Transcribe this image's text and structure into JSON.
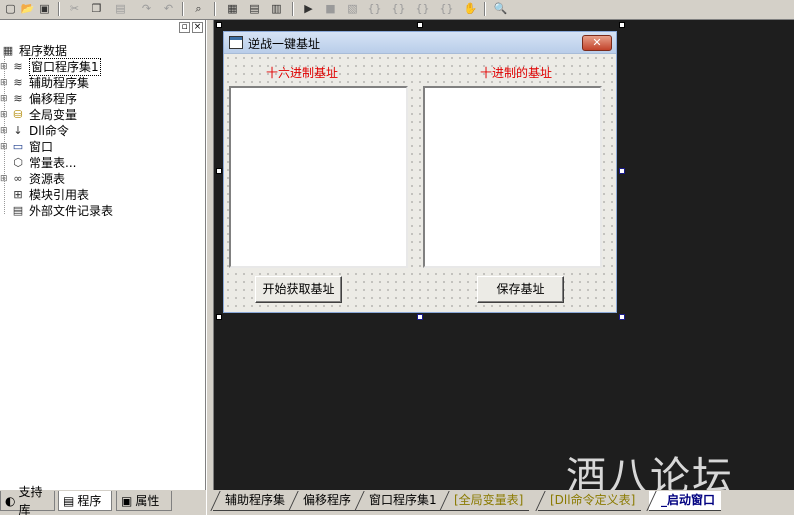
{
  "toolbar": {
    "buttons": [
      {
        "name": "new",
        "glyph": "▢"
      },
      {
        "name": "open",
        "glyph": "📂"
      },
      {
        "name": "save",
        "glyph": "▣"
      },
      {
        "name": "cut",
        "glyph": "✂"
      },
      {
        "name": "copy",
        "glyph": "❐"
      },
      {
        "name": "paste",
        "glyph": "▤"
      },
      {
        "name": "redo",
        "glyph": "↷"
      },
      {
        "name": "undo",
        "glyph": "↶"
      },
      {
        "name": "preview",
        "glyph": "⌕"
      },
      {
        "name": "layout1",
        "glyph": "▦"
      },
      {
        "name": "layout2",
        "glyph": "▤"
      },
      {
        "name": "layout3",
        "glyph": "▥"
      },
      {
        "name": "run",
        "glyph": "▶"
      },
      {
        "name": "stop",
        "glyph": "■"
      },
      {
        "name": "compile",
        "glyph": "▧"
      },
      {
        "name": "step-into",
        "glyph": "{}"
      },
      {
        "name": "step-over",
        "glyph": "{}"
      },
      {
        "name": "step-out",
        "glyph": "{}"
      },
      {
        "name": "step-run",
        "glyph": "{}"
      },
      {
        "name": "hand",
        "glyph": "✋"
      },
      {
        "name": "find",
        "glyph": "🔍"
      }
    ]
  },
  "tree": {
    "root": "程序数据",
    "items": [
      {
        "label": "窗口程序集1",
        "icon": "stack-icon",
        "glyph": "≋",
        "selected": true
      },
      {
        "label": "辅助程序集",
        "icon": "stack-icon",
        "glyph": "≋"
      },
      {
        "label": "偏移程序",
        "icon": "stack-icon",
        "glyph": "≋"
      },
      {
        "label": "全局变量",
        "icon": "variable-icon",
        "glyph": "⛁"
      },
      {
        "label": "Dll命令",
        "icon": "dll-icon",
        "glyph": "↓"
      },
      {
        "label": "窗口",
        "icon": "window-icon",
        "glyph": "▭"
      },
      {
        "label": "常量表...",
        "icon": "constant-icon",
        "glyph": "⬡"
      },
      {
        "label": "资源表",
        "icon": "resource-icon",
        "glyph": "∞"
      },
      {
        "label": "模块引用表",
        "icon": "module-icon",
        "glyph": "⊞"
      },
      {
        "label": "外部文件记录表",
        "icon": "file-icon",
        "glyph": "▤"
      }
    ]
  },
  "left_tabs": [
    {
      "label": "支持库",
      "glyph": "◐"
    },
    {
      "label": "程序",
      "glyph": "▤"
    },
    {
      "label": "属性",
      "glyph": "▣"
    }
  ],
  "form": {
    "title": "逆战一键基址",
    "close_glyph": "✕",
    "label_hex": "十六进制基址",
    "label_dec": "十进制的基址",
    "button_start": "开始获取基址",
    "button_save": "保存基址"
  },
  "doc_tabs": [
    {
      "label": "辅助程序集",
      "style": "normal"
    },
    {
      "label": "偏移程序",
      "style": "normal"
    },
    {
      "label": "窗口程序集1",
      "style": "normal"
    },
    {
      "label": "[全局变量表]",
      "style": "olive"
    },
    {
      "label": "[Dll命令定义表]",
      "style": "olive"
    },
    {
      "label": "_启动窗口",
      "style": "active"
    }
  ],
  "panel_controls": {
    "pin": "▫",
    "close": "×"
  },
  "watermark": "酒八论坛"
}
